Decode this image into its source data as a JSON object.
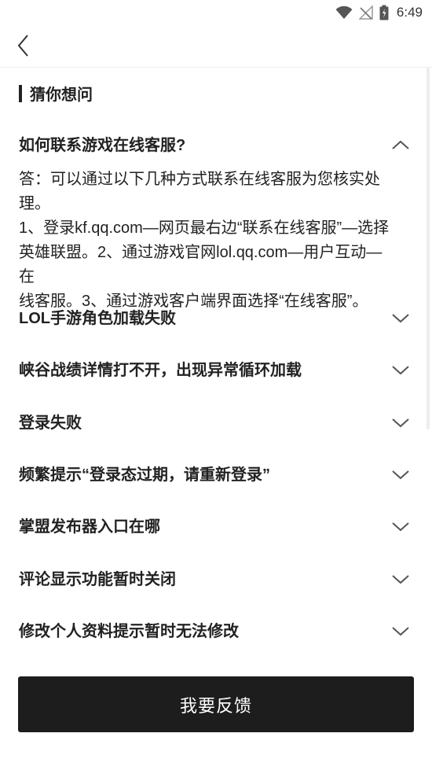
{
  "status_bar": {
    "time": "6:49",
    "icons": [
      "wifi-icon",
      "no-signal-icon",
      "battery-icon"
    ]
  },
  "nav": {
    "back_icon": "chevron-left-icon"
  },
  "section": {
    "title": "猜你想问"
  },
  "faq": {
    "items": [
      {
        "question": "如何联系游戏在线客服?",
        "expanded": true,
        "answer_lines": [
          "答：可以通过以下几种方式联系在线客服为您核实处",
          "理。",
          "1、登录kf.qq.com—网页最右边“联系在线客服”—选择",
          "英雄联盟。2、通过游戏官网lol.qq.com—用户互动—在",
          "线客服。3、通过游戏客户端界面选择“在线客服”。"
        ]
      },
      {
        "question": "LOL手游角色加载失败",
        "expanded": false
      },
      {
        "question": "峡谷战绩详情打不开，出现异常循环加载",
        "expanded": false
      },
      {
        "question": "登录失败",
        "expanded": false
      },
      {
        "question": "频繁提示“登录态过期，请重新登录”",
        "expanded": false
      },
      {
        "question": "掌盟发布器入口在哪",
        "expanded": false
      },
      {
        "question": "评论显示功能暂时关闭",
        "expanded": false
      },
      {
        "question": "修改个人资料提示暂时无法修改",
        "expanded": false
      }
    ]
  },
  "feedback_button": {
    "label": "我要反馈"
  },
  "colors": {
    "text": "#222222",
    "button_bg": "#1d1d1d",
    "button_text": "#ffffff",
    "chevron": "#555555"
  }
}
